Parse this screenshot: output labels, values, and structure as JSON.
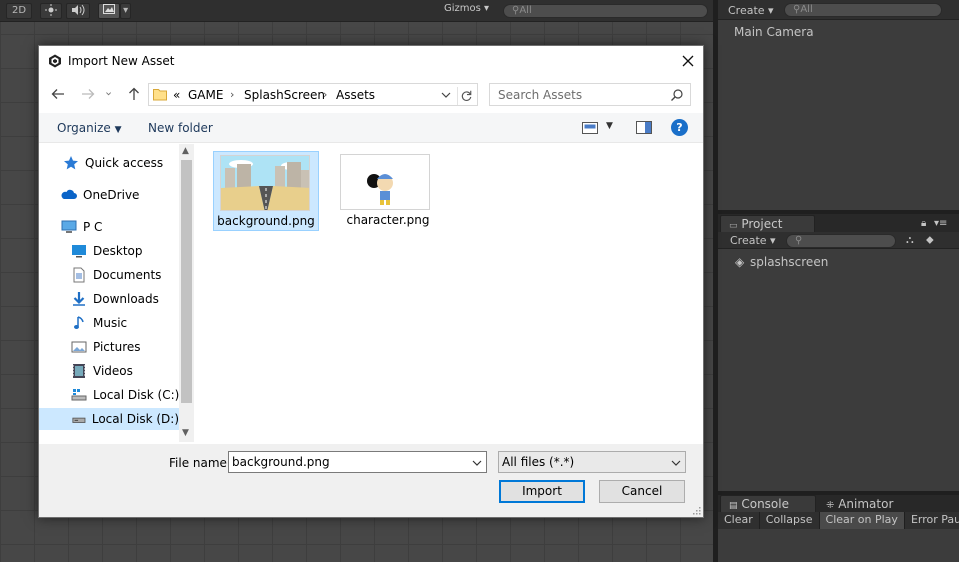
{
  "unity": {
    "scene_toolbar": {
      "mode_2d": "2D",
      "gizmos": "Gizmos",
      "search_placeholder": "All"
    },
    "hierarchy": {
      "create": "Create",
      "search_placeholder": "All",
      "items": [
        "Main Camera"
      ]
    },
    "project": {
      "tab": "Project",
      "create": "Create",
      "items": [
        "splashscreen"
      ]
    },
    "console": {
      "tab": "Console",
      "tab2": "Animator",
      "buttons": [
        "Clear",
        "Collapse",
        "Clear on Play",
        "Error Pause"
      ]
    }
  },
  "dialog": {
    "title": "Import New Asset",
    "breadcrumb": [
      "GAME",
      "SplashScreen",
      "Assets"
    ],
    "breadcrumb_prefix": "«",
    "search_placeholder": "Search Assets",
    "organize": "Organize",
    "new_folder": "New folder",
    "help": "?",
    "nav": [
      {
        "label": "Quick access",
        "icon": "star-icon"
      },
      {
        "label": "OneDrive",
        "icon": "cloud-icon"
      },
      {
        "label": "P C",
        "icon": "pc-icon"
      },
      {
        "label": "Desktop",
        "icon": "desktop-icon"
      },
      {
        "label": "Documents",
        "icon": "documents-icon"
      },
      {
        "label": "Downloads",
        "icon": "downloads-icon"
      },
      {
        "label": "Music",
        "icon": "music-icon"
      },
      {
        "label": "Pictures",
        "icon": "pictures-icon"
      },
      {
        "label": "Videos",
        "icon": "videos-icon"
      },
      {
        "label": "Local Disk (C:)",
        "icon": "drive-c-icon"
      },
      {
        "label": "Local Disk (D:)",
        "icon": "drive-d-icon",
        "selected": true
      }
    ],
    "files": [
      {
        "name": "background.png",
        "selected": true
      },
      {
        "name": "character.png",
        "selected": false
      }
    ],
    "file_name_label": "File name:",
    "file_name_value": "background.png",
    "file_type": "All files (*.*)",
    "import_label": "Import",
    "cancel_label": "Cancel",
    "colors": {
      "selection": "#cce8ff",
      "accent": "#0078d7",
      "help": "#1a6fc9"
    }
  }
}
